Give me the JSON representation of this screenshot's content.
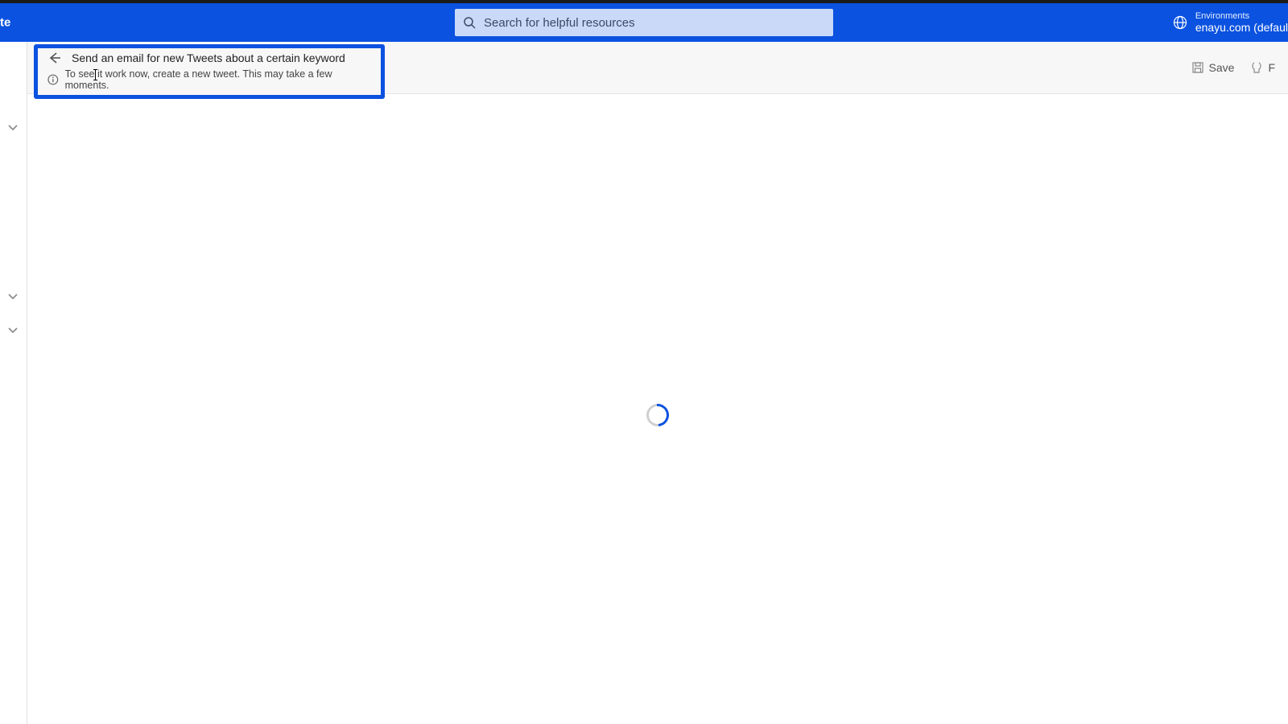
{
  "header": {
    "left_partial_text": "te",
    "search_placeholder": "Search for helpful resources",
    "env_label": "Environments",
    "env_name": "enayu.com (defaul"
  },
  "toolbar": {
    "save_label": "Save",
    "extra_partial": "F"
  },
  "flow": {
    "title": "Send an email for new Tweets about a certain keyword",
    "info_text": "To see it work now, create a new tweet. This may take a few moments."
  }
}
